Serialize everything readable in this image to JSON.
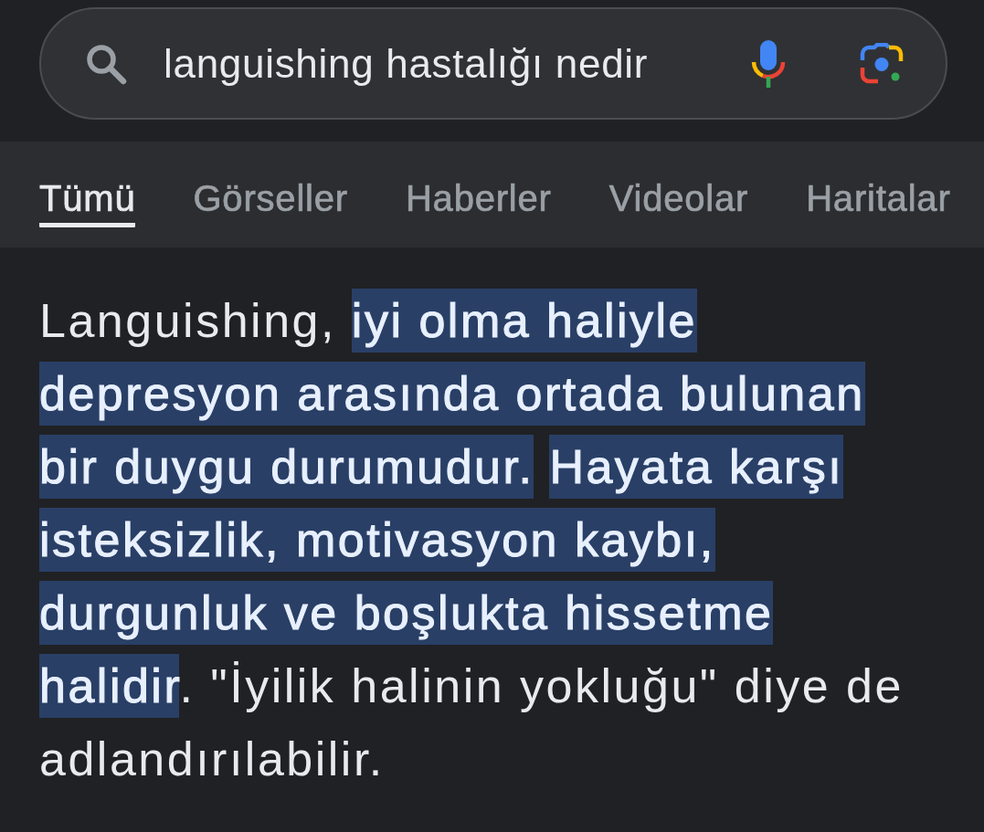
{
  "search": {
    "value": "languishing hastalığı nedir"
  },
  "tabs": [
    {
      "label": "Tümü",
      "selected": true
    },
    {
      "label": "Görseller",
      "selected": false
    },
    {
      "label": "Haberler",
      "selected": false
    },
    {
      "label": "Videolar",
      "selected": false
    },
    {
      "label": "Haritalar",
      "selected": false
    }
  ],
  "answer": {
    "text": "Languishing, **iyi olma haliyle depresyon arasında ortada bulunan bir duygu durumudur.** **Hayata karşı isteksizlik, motivasyon kaybı, durgunluk ve boşlukta hissetme halidir**. \"İyilik halinin yokluğu\" diye de adlandırılabilir."
  }
}
